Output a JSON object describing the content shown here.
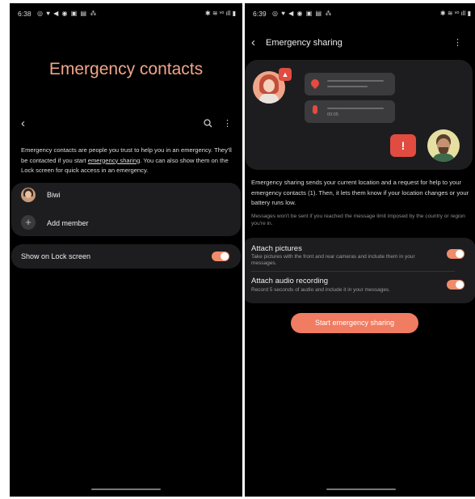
{
  "left": {
    "status": {
      "time": "6:38",
      "notifications": "◎ ♥ ◀ ◉ ▣ ▤ ⁂",
      "system": "✱ ≋ ᵛᵒ ıll ▮"
    },
    "title": "Emergency contacts",
    "description": {
      "before": "Emergency contacts are people you trust to help you in an emergency. They'll be contacted if you start ",
      "link": "emergency sharing",
      "after": ". You can also show them on the Lock screen for quick access in an emergency."
    },
    "contacts": [
      {
        "name": "Biwi"
      }
    ],
    "add_member_label": "Add member",
    "lock_screen_label": "Show on Lock screen",
    "lock_screen_enabled": true
  },
  "right": {
    "status": {
      "time": "6:39",
      "notifications": "◎ ♥ ◀ ◉ ▣ ▤ ⁂",
      "system": "✱ ≋ ᵛᵒ ıll ▮"
    },
    "title": "Emergency sharing",
    "audio_duration": "00:05",
    "description": "Emergency sharing sends your current location and a request for help to your emergency contacts (1). Then, it lets them know if your location changes or your battery runs low.",
    "note": "Messages won't be sent if you reached the message limit imposed by the country or region you're in.",
    "settings": [
      {
        "title": "Attach pictures",
        "subtitle": "Take pictures with the front and rear cameras and include them in your messages.",
        "enabled": true
      },
      {
        "title": "Attach audio recording",
        "subtitle": "Record 5 seconds of audio and include it in your messages.",
        "enabled": true
      }
    ],
    "start_button": "Start emergency sharing"
  },
  "colors": {
    "accent": "#f07c62",
    "title": "#f0a58a",
    "card": "#1d1d1f",
    "alert": "#e24b40"
  }
}
